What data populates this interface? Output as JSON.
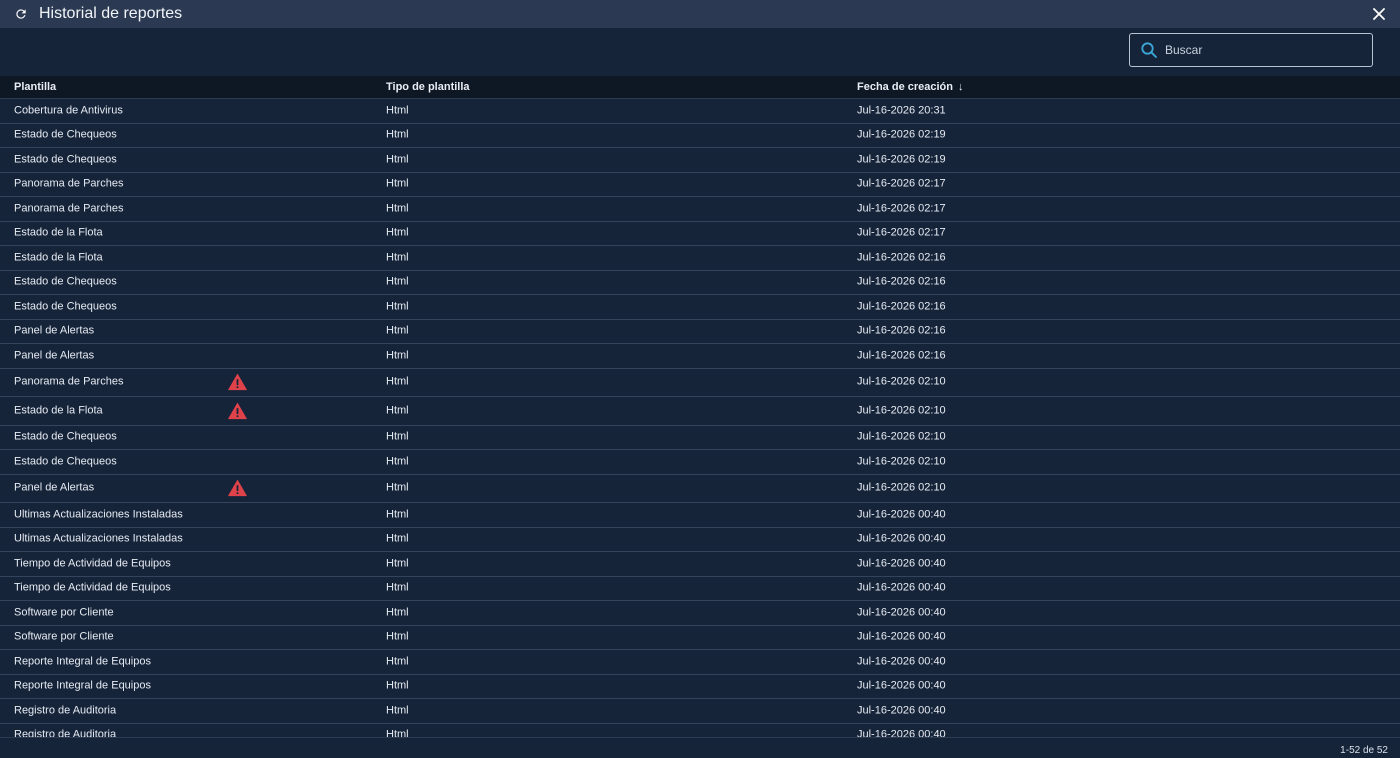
{
  "window": {
    "title": "Historial de reportes",
    "refresh_icon": "refresh-icon",
    "close_icon": "close-icon"
  },
  "search": {
    "placeholder": "Buscar",
    "value": ""
  },
  "columns": {
    "template": "Plantilla",
    "type": "Tipo de plantilla",
    "created": "Fecha de creación",
    "sort_indicator": "↓"
  },
  "colors": {
    "titlebar": "#2b3a52",
    "background": "#16243a",
    "header": "#0e1724",
    "warning": "#e0424a",
    "search_icon": "#3aa8d8"
  },
  "rows": [
    {
      "template": "Cobertura de Antivirus",
      "type": "Html",
      "created": "Jul-16-2026 20:31",
      "warning": false
    },
    {
      "template": "Estado de Chequeos",
      "type": "Html",
      "created": "Jul-16-2026 02:19",
      "warning": false
    },
    {
      "template": "Estado de Chequeos",
      "type": "Html",
      "created": "Jul-16-2026 02:19",
      "warning": false
    },
    {
      "template": "Panorama de Parches",
      "type": "Html",
      "created": "Jul-16-2026 02:17",
      "warning": false
    },
    {
      "template": "Panorama de Parches",
      "type": "Html",
      "created": "Jul-16-2026 02:17",
      "warning": false
    },
    {
      "template": "Estado de la Flota",
      "type": "Html",
      "created": "Jul-16-2026 02:17",
      "warning": false
    },
    {
      "template": "Estado de la Flota",
      "type": "Html",
      "created": "Jul-16-2026 02:16",
      "warning": false
    },
    {
      "template": "Estado de Chequeos",
      "type": "Html",
      "created": "Jul-16-2026 02:16",
      "warning": false
    },
    {
      "template": "Estado de Chequeos",
      "type": "Html",
      "created": "Jul-16-2026 02:16",
      "warning": false
    },
    {
      "template": "Panel de Alertas",
      "type": "Html",
      "created": "Jul-16-2026 02:16",
      "warning": false
    },
    {
      "template": "Panel de Alertas",
      "type": "Html",
      "created": "Jul-16-2026 02:16",
      "warning": false
    },
    {
      "template": "Panorama de Parches",
      "type": "Html",
      "created": "Jul-16-2026 02:10",
      "warning": true
    },
    {
      "template": "Estado de la Flota",
      "type": "Html",
      "created": "Jul-16-2026 02:10",
      "warning": true
    },
    {
      "template": "Estado de Chequeos",
      "type": "Html",
      "created": "Jul-16-2026 02:10",
      "warning": false
    },
    {
      "template": "Estado de Chequeos",
      "type": "Html",
      "created": "Jul-16-2026 02:10",
      "warning": false
    },
    {
      "template": "Panel de Alertas",
      "type": "Html",
      "created": "Jul-16-2026 02:10",
      "warning": true
    },
    {
      "template": "Ultimas Actualizaciones Instaladas",
      "type": "Html",
      "created": "Jul-16-2026 00:40",
      "warning": false
    },
    {
      "template": "Ultimas Actualizaciones Instaladas",
      "type": "Html",
      "created": "Jul-16-2026 00:40",
      "warning": false
    },
    {
      "template": "Tiempo de Actividad de Equipos",
      "type": "Html",
      "created": "Jul-16-2026 00:40",
      "warning": false
    },
    {
      "template": "Tiempo de Actividad de Equipos",
      "type": "Html",
      "created": "Jul-16-2026 00:40",
      "warning": false
    },
    {
      "template": "Software por Cliente",
      "type": "Html",
      "created": "Jul-16-2026 00:40",
      "warning": false
    },
    {
      "template": "Software por Cliente",
      "type": "Html",
      "created": "Jul-16-2026 00:40",
      "warning": false
    },
    {
      "template": "Reporte Integral de Equipos",
      "type": "Html",
      "created": "Jul-16-2026 00:40",
      "warning": false
    },
    {
      "template": "Reporte Integral de Equipos",
      "type": "Html",
      "created": "Jul-16-2026 00:40",
      "warning": false
    },
    {
      "template": "Registro de Auditoria",
      "type": "Html",
      "created": "Jul-16-2026 00:40",
      "warning": false
    },
    {
      "template": "Registro de Auditoria",
      "type": "Html",
      "created": "Jul-16-2026 00:40",
      "warning": false
    }
  ],
  "pagination": {
    "text": "1-52 de 52"
  }
}
